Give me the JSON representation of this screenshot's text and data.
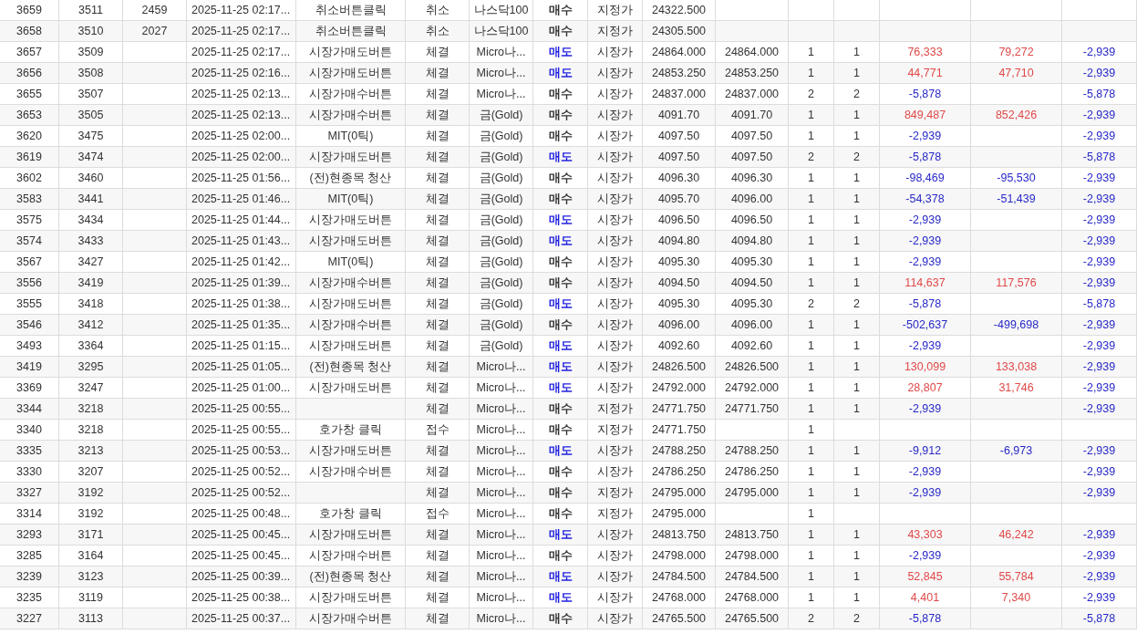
{
  "table": {
    "rows": [
      {
        "column_1": "3659",
        "column_2": "3511",
        "column_3": "2459",
        "column_4": "2025-11-25 02:17...",
        "column_5": "취소버튼클릭",
        "column_6": "취소",
        "column_7": "나스닥100",
        "column_8": {
          "text": "매수",
          "color": "#333333"
        },
        "column_9": "지정가",
        "column_10": "24322.500"
      },
      {
        "column_1": "3658",
        "column_2": "3510",
        "column_3": "2027",
        "column_4": "2025-11-25 02:17...",
        "column_5": "취소버튼클릭",
        "column_6": "취소",
        "column_7": "나스닥100",
        "column_8": {
          "text": "매수",
          "color": "#333333"
        },
        "column_9": "지정가",
        "column_10": "24305.500"
      },
      {
        "column_1": "3657",
        "column_2": "3509",
        "column_4": "2025-11-25 02:17...",
        "column_5": "시장가매도버튼",
        "column_6": "체결",
        "column_7": "Micro나...",
        "column_8": {
          "text": "매도",
          "color": "#1c1ce0"
        },
        "column_9": "시장가",
        "column_10": "24864.000",
        "column_11": "24864.000",
        "column_12": "1",
        "column_13": "1",
        "column_14": {
          "text": "76,333",
          "color": "#e04848"
        },
        "column_15": {
          "text": "79,272",
          "color": "#e04848"
        },
        "column_16": {
          "text": "-2,939",
          "color": "#2828c8"
        }
      },
      {
        "column_1": "3656",
        "column_2": "3508",
        "column_4": "2025-11-25 02:16...",
        "column_5": "시장가매도버튼",
        "column_6": "체결",
        "column_7": "Micro나...",
        "column_8": {
          "text": "매도",
          "color": "#1c1ce0"
        },
        "column_9": "시장가",
        "column_10": "24853.250",
        "column_11": "24853.250",
        "column_12": "1",
        "column_13": "1",
        "column_14": {
          "text": "44,771",
          "color": "#e04848"
        },
        "column_15": {
          "text": "47,710",
          "color": "#e04848"
        },
        "column_16": {
          "text": "-2,939",
          "color": "#2828c8"
        }
      },
      {
        "column_1": "3655",
        "column_2": "3507",
        "column_4": "2025-11-25 02:13...",
        "column_5": "시장가매수버튼",
        "column_6": "체결",
        "column_7": "Micro나...",
        "column_8": {
          "text": "매수",
          "color": "#333333"
        },
        "column_9": "시장가",
        "column_10": "24837.000",
        "column_11": "24837.000",
        "column_12": "2",
        "column_13": "2",
        "column_14": {
          "text": "-5,878",
          "color": "#2828c8"
        },
        "column_16": {
          "text": "-5,878",
          "color": "#2828c8"
        }
      },
      {
        "column_1": "3653",
        "column_2": "3505",
        "column_4": "2025-11-25 02:13...",
        "column_5": "시장가매수버튼",
        "column_6": "체결",
        "column_7": "금(Gold)",
        "column_8": {
          "text": "매수",
          "color": "#333333"
        },
        "column_9": "시장가",
        "column_10": "4091.70",
        "column_11": "4091.70",
        "column_12": "1",
        "column_13": "1",
        "column_14": {
          "text": "849,487",
          "color": "#e04848"
        },
        "column_15": {
          "text": "852,426",
          "color": "#e04848"
        },
        "column_16": {
          "text": "-2,939",
          "color": "#2828c8"
        }
      },
      {
        "column_1": "3620",
        "column_2": "3475",
        "column_4": "2025-11-25 02:00...",
        "column_5": "MIT(0틱)",
        "column_6": "체결",
        "column_7": "금(Gold)",
        "column_8": {
          "text": "매수",
          "color": "#333333"
        },
        "column_9": "시장가",
        "column_10": "4097.50",
        "column_11": "4097.50",
        "column_12": "1",
        "column_13": "1",
        "column_14": {
          "text": "-2,939",
          "color": "#2828c8"
        },
        "column_16": {
          "text": "-2,939",
          "color": "#2828c8"
        }
      },
      {
        "column_1": "3619",
        "column_2": "3474",
        "column_4": "2025-11-25 02:00...",
        "column_5": "시장가매도버튼",
        "column_6": "체결",
        "column_7": "금(Gold)",
        "column_8": {
          "text": "매도",
          "color": "#1c1ce0"
        },
        "column_9": "시장가",
        "column_10": "4097.50",
        "column_11": "4097.50",
        "column_12": "2",
        "column_13": "2",
        "column_14": {
          "text": "-5,878",
          "color": "#2828c8"
        },
        "column_16": {
          "text": "-5,878",
          "color": "#2828c8"
        }
      },
      {
        "column_1": "3602",
        "column_2": "3460",
        "column_4": "2025-11-25 01:56...",
        "column_5": "(전)현종목 청산",
        "column_6": "체결",
        "column_7": "금(Gold)",
        "column_8": {
          "text": "매수",
          "color": "#333333"
        },
        "column_9": "시장가",
        "column_10": "4096.30",
        "column_11": "4096.30",
        "column_12": "1",
        "column_13": "1",
        "column_14": {
          "text": "-98,469",
          "color": "#2828c8"
        },
        "column_15": {
          "text": "-95,530",
          "color": "#2828c8"
        },
        "column_16": {
          "text": "-2,939",
          "color": "#2828c8"
        }
      },
      {
        "column_1": "3583",
        "column_2": "3441",
        "column_4": "2025-11-25 01:46...",
        "column_5": "MIT(0틱)",
        "column_6": "체결",
        "column_7": "금(Gold)",
        "column_8": {
          "text": "매수",
          "color": "#333333"
        },
        "column_9": "시장가",
        "column_10": "4095.70",
        "column_11": "4096.00",
        "column_12": "1",
        "column_13": "1",
        "column_14": {
          "text": "-54,378",
          "color": "#2828c8"
        },
        "column_15": {
          "text": "-51,439",
          "color": "#2828c8"
        },
        "column_16": {
          "text": "-2,939",
          "color": "#2828c8"
        }
      },
      {
        "column_1": "3575",
        "column_2": "3434",
        "column_4": "2025-11-25 01:44...",
        "column_5": "시장가매도버튼",
        "column_6": "체결",
        "column_7": "금(Gold)",
        "column_8": {
          "text": "매도",
          "color": "#1c1ce0"
        },
        "column_9": "시장가",
        "column_10": "4096.50",
        "column_11": "4096.50",
        "column_12": "1",
        "column_13": "1",
        "column_14": {
          "text": "-2,939",
          "color": "#2828c8"
        },
        "column_16": {
          "text": "-2,939",
          "color": "#2828c8"
        }
      },
      {
        "column_1": "3574",
        "column_2": "3433",
        "column_4": "2025-11-25 01:43...",
        "column_5": "시장가매도버튼",
        "column_6": "체결",
        "column_7": "금(Gold)",
        "column_8": {
          "text": "매도",
          "color": "#1c1ce0"
        },
        "column_9": "시장가",
        "column_10": "4094.80",
        "column_11": "4094.80",
        "column_12": "1",
        "column_13": "1",
        "column_14": {
          "text": "-2,939",
          "color": "#2828c8"
        },
        "column_16": {
          "text": "-2,939",
          "color": "#2828c8"
        }
      },
      {
        "column_1": "3567",
        "column_2": "3427",
        "column_4": "2025-11-25 01:42...",
        "column_5": "MIT(0틱)",
        "column_6": "체결",
        "column_7": "금(Gold)",
        "column_8": {
          "text": "매수",
          "color": "#333333"
        },
        "column_9": "시장가",
        "column_10": "4095.30",
        "column_11": "4095.30",
        "column_12": "1",
        "column_13": "1",
        "column_14": {
          "text": "-2,939",
          "color": "#2828c8"
        },
        "column_16": {
          "text": "-2,939",
          "color": "#2828c8"
        }
      },
      {
        "column_1": "3556",
        "column_2": "3419",
        "column_4": "2025-11-25 01:39...",
        "column_5": "시장가매수버튼",
        "column_6": "체결",
        "column_7": "금(Gold)",
        "column_8": {
          "text": "매수",
          "color": "#333333"
        },
        "column_9": "시장가",
        "column_10": "4094.50",
        "column_11": "4094.50",
        "column_12": "1",
        "column_13": "1",
        "column_14": {
          "text": "114,637",
          "color": "#e04848"
        },
        "column_15": {
          "text": "117,576",
          "color": "#e04848"
        },
        "column_16": {
          "text": "-2,939",
          "color": "#2828c8"
        }
      },
      {
        "column_1": "3555",
        "column_2": "3418",
        "column_4": "2025-11-25 01:38...",
        "column_5": "시장가매도버튼",
        "column_6": "체결",
        "column_7": "금(Gold)",
        "column_8": {
          "text": "매도",
          "color": "#1c1ce0"
        },
        "column_9": "시장가",
        "column_10": "4095.30",
        "column_11": "4095.30",
        "column_12": "2",
        "column_13": "2",
        "column_14": {
          "text": "-5,878",
          "color": "#2828c8"
        },
        "column_16": {
          "text": "-5,878",
          "color": "#2828c8"
        }
      },
      {
        "column_1": "3546",
        "column_2": "3412",
        "column_4": "2025-11-25 01:35...",
        "column_5": "시장가매수버튼",
        "column_6": "체결",
        "column_7": "금(Gold)",
        "column_8": {
          "text": "매수",
          "color": "#333333"
        },
        "column_9": "시장가",
        "column_10": "4096.00",
        "column_11": "4096.00",
        "column_12": "1",
        "column_13": "1",
        "column_14": {
          "text": "-502,637",
          "color": "#2828c8"
        },
        "column_15": {
          "text": "-499,698",
          "color": "#2828c8"
        },
        "column_16": {
          "text": "-2,939",
          "color": "#2828c8"
        }
      },
      {
        "column_1": "3493",
        "column_2": "3364",
        "column_4": "2025-11-25 01:15...",
        "column_5": "시장가매도버튼",
        "column_6": "체결",
        "column_7": "금(Gold)",
        "column_8": {
          "text": "매도",
          "color": "#1c1ce0"
        },
        "column_9": "시장가",
        "column_10": "4092.60",
        "column_11": "4092.60",
        "column_12": "1",
        "column_13": "1",
        "column_14": {
          "text": "-2,939",
          "color": "#2828c8"
        },
        "column_16": {
          "text": "-2,939",
          "color": "#2828c8"
        }
      },
      {
        "column_1": "3419",
        "column_2": "3295",
        "column_4": "2025-11-25 01:05...",
        "column_5": "(전)현종목 청산",
        "column_6": "체결",
        "column_7": "Micro나...",
        "column_8": {
          "text": "매도",
          "color": "#1c1ce0"
        },
        "column_9": "시장가",
        "column_10": "24826.500",
        "column_11": "24826.500",
        "column_12": "1",
        "column_13": "1",
        "column_14": {
          "text": "130,099",
          "color": "#e04848"
        },
        "column_15": {
          "text": "133,038",
          "color": "#e04848"
        },
        "column_16": {
          "text": "-2,939",
          "color": "#2828c8"
        }
      },
      {
        "column_1": "3369",
        "column_2": "3247",
        "column_4": "2025-11-25 01:00...",
        "column_5": "시장가매도버튼",
        "column_6": "체결",
        "column_7": "Micro나...",
        "column_8": {
          "text": "매도",
          "color": "#1c1ce0"
        },
        "column_9": "시장가",
        "column_10": "24792.000",
        "column_11": "24792.000",
        "column_12": "1",
        "column_13": "1",
        "column_14": {
          "text": "28,807",
          "color": "#e04848"
        },
        "column_15": {
          "text": "31,746",
          "color": "#e04848"
        },
        "column_16": {
          "text": "-2,939",
          "color": "#2828c8"
        }
      },
      {
        "column_1": "3344",
        "column_2": "3218",
        "column_4": "2025-11-25 00:55...",
        "column_6": "체결",
        "column_7": "Micro나...",
        "column_8": {
          "text": "매수",
          "color": "#333333"
        },
        "column_9": "지정가",
        "column_10": "24771.750",
        "column_11": "24771.750",
        "column_12": "1",
        "column_13": "1",
        "column_14": {
          "text": "-2,939",
          "color": "#2828c8"
        },
        "column_16": {
          "text": "-2,939",
          "color": "#2828c8"
        }
      },
      {
        "column_1": "3340",
        "column_2": "3218",
        "column_4": "2025-11-25 00:55...",
        "column_5": "호가창 클릭",
        "column_6": "접수",
        "column_7": "Micro나...",
        "column_8": {
          "text": "매수",
          "color": "#333333"
        },
        "column_9": "지정가",
        "column_10": "24771.750",
        "column_12": "1"
      },
      {
        "column_1": "3335",
        "column_2": "3213",
        "column_4": "2025-11-25 00:53...",
        "column_5": "시장가매도버튼",
        "column_6": "체결",
        "column_7": "Micro나...",
        "column_8": {
          "text": "매도",
          "color": "#1c1ce0"
        },
        "column_9": "시장가",
        "column_10": "24788.250",
        "column_11": "24788.250",
        "column_12": "1",
        "column_13": "1",
        "column_14": {
          "text": "-9,912",
          "color": "#2828c8"
        },
        "column_15": {
          "text": "-6,973",
          "color": "#2828c8"
        },
        "column_16": {
          "text": "-2,939",
          "color": "#2828c8"
        }
      },
      {
        "column_1": "3330",
        "column_2": "3207",
        "column_4": "2025-11-25 00:52...",
        "column_5": "시장가매수버튼",
        "column_6": "체결",
        "column_7": "Micro나...",
        "column_8": {
          "text": "매수",
          "color": "#333333"
        },
        "column_9": "시장가",
        "column_10": "24786.250",
        "column_11": "24786.250",
        "column_12": "1",
        "column_13": "1",
        "column_14": {
          "text": "-2,939",
          "color": "#2828c8"
        },
        "column_16": {
          "text": "-2,939",
          "color": "#2828c8"
        }
      },
      {
        "column_1": "3327",
        "column_2": "3192",
        "column_4": "2025-11-25 00:52...",
        "column_6": "체결",
        "column_7": "Micro나...",
        "column_8": {
          "text": "매수",
          "color": "#333333"
        },
        "column_9": "지정가",
        "column_10": "24795.000",
        "column_11": "24795.000",
        "column_12": "1",
        "column_13": "1",
        "column_14": {
          "text": "-2,939",
          "color": "#2828c8"
        },
        "column_16": {
          "text": "-2,939",
          "color": "#2828c8"
        }
      },
      {
        "column_1": "3314",
        "column_2": "3192",
        "column_4": "2025-11-25 00:48...",
        "column_5": "호가창 클릭",
        "column_6": "접수",
        "column_7": "Micro나...",
        "column_8": {
          "text": "매수",
          "color": "#333333"
        },
        "column_9": "지정가",
        "column_10": "24795.000",
        "column_12": "1"
      },
      {
        "column_1": "3293",
        "column_2": "3171",
        "column_4": "2025-11-25 00:45...",
        "column_5": "시장가매도버튼",
        "column_6": "체결",
        "column_7": "Micro나...",
        "column_8": {
          "text": "매도",
          "color": "#1c1ce0"
        },
        "column_9": "시장가",
        "column_10": "24813.750",
        "column_11": "24813.750",
        "column_12": "1",
        "column_13": "1",
        "column_14": {
          "text": "43,303",
          "color": "#e04848"
        },
        "column_15": {
          "text": "46,242",
          "color": "#e04848"
        },
        "column_16": {
          "text": "-2,939",
          "color": "#2828c8"
        }
      },
      {
        "column_1": "3285",
        "column_2": "3164",
        "column_4": "2025-11-25 00:45...",
        "column_5": "시장가매수버튼",
        "column_6": "체결",
        "column_7": "Micro나...",
        "column_8": {
          "text": "매수",
          "color": "#333333"
        },
        "column_9": "시장가",
        "column_10": "24798.000",
        "column_11": "24798.000",
        "column_12": "1",
        "column_13": "1",
        "column_14": {
          "text": "-2,939",
          "color": "#2828c8"
        },
        "column_16": {
          "text": "-2,939",
          "color": "#2828c8"
        }
      },
      {
        "column_1": "3239",
        "column_2": "3123",
        "column_4": "2025-11-25 00:39...",
        "column_5": "(전)현종목 청산",
        "column_6": "체결",
        "column_7": "Micro나...",
        "column_8": {
          "text": "매도",
          "color": "#1c1ce0"
        },
        "column_9": "시장가",
        "column_10": "24784.500",
        "column_11": "24784.500",
        "column_12": "1",
        "column_13": "1",
        "column_14": {
          "text": "52,845",
          "color": "#e04848"
        },
        "column_15": {
          "text": "55,784",
          "color": "#e04848"
        },
        "column_16": {
          "text": "-2,939",
          "color": "#2828c8"
        }
      },
      {
        "column_1": "3235",
        "column_2": "3119",
        "column_4": "2025-11-25 00:38...",
        "column_5": "시장가매도버튼",
        "column_6": "체결",
        "column_7": "Micro나...",
        "column_8": {
          "text": "매도",
          "color": "#1c1ce0"
        },
        "column_9": "시장가",
        "column_10": "24768.000",
        "column_11": "24768.000",
        "column_12": "1",
        "column_13": "1",
        "column_14": {
          "text": "4,401",
          "color": "#e04848"
        },
        "column_15": {
          "text": "7,340",
          "color": "#e04848"
        },
        "column_16": {
          "text": "-2,939",
          "color": "#2828c8"
        }
      },
      {
        "column_1": "3227",
        "column_2": "3113",
        "column_4": "2025-11-25 00:37...",
        "column_5": "시장가매수버튼",
        "column_6": "체결",
        "column_7": "Micro나...",
        "column_8": {
          "text": "매수",
          "color": "#333333"
        },
        "column_9": "시장가",
        "column_10": "24765.500",
        "column_11": "24765.500",
        "column_12": "2",
        "column_13": "2",
        "column_14": {
          "text": "-5,878",
          "color": "#2828c8"
        },
        "column_16": {
          "text": "-5,878",
          "color": "#2828c8"
        }
      }
    ]
  }
}
